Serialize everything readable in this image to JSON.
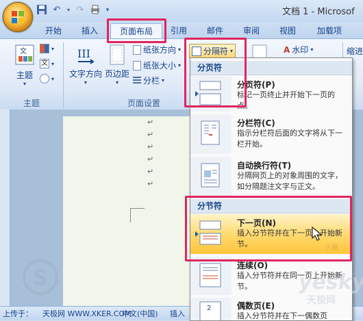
{
  "window": {
    "title": "文档 1 - Microsof"
  },
  "quick_access": {
    "icons": [
      "save-icon",
      "undo-icon",
      "redo-icon",
      "print-icon",
      "customize-icon"
    ]
  },
  "tabs": [
    {
      "label": "开始"
    },
    {
      "label": "插入"
    },
    {
      "label": "页面布局",
      "active": true
    },
    {
      "label": "引用"
    },
    {
      "label": "邮件"
    },
    {
      "label": "审阅"
    },
    {
      "label": "视图"
    },
    {
      "label": "加载项"
    }
  ],
  "ribbon": {
    "theme_group": {
      "theme_label": "主题",
      "group_label": "主题"
    },
    "page_setup_group": {
      "text_direction_label": "文字方向",
      "margins_label": "页边距",
      "orientation_label": "纸张方向",
      "size_label": "纸张大小",
      "columns_label": "分栏",
      "breaks_label": "分隔符",
      "group_label": "页面设置"
    },
    "background_group": {
      "watermark_label": "水印"
    },
    "indent_label": "缩进"
  },
  "breaks_menu": {
    "page_breaks_header": "分页符",
    "section_breaks_header": "分节符",
    "items": [
      {
        "title": "分页符(P)",
        "desc": "标记一页终止并开始下一页的点。"
      },
      {
        "title": "分栏符(C)",
        "desc": "指示分栏符后面的文字将从下一栏开始。"
      },
      {
        "title": "自动换行符(T)",
        "desc": "分隔网页上的对象周围的文字，如分隔题注文字与正文。"
      },
      {
        "title": "下一页(N)",
        "desc": "插入分节符并在下一页上开始新节。",
        "selected": true
      },
      {
        "title": "连续(O)",
        "desc": "插入分节符并在同一页上开始新节。"
      },
      {
        "title": "偶数页(E)",
        "desc": "插入分节符并在下一偶数页"
      }
    ]
  },
  "statusbar": {
    "left_text": "上传于：",
    "watermark_site": "天极网 WWW.XKER.COM",
    "language": "中文(中国)",
    "insert_mode": "插入"
  },
  "watermarks": {
    "small_tag": "小易",
    "brand_top": "yesky",
    "brand_bottom": "天极网"
  },
  "colors": {
    "highlight": "#e0245e",
    "selected_item": "#ffd86b",
    "ribbon_text": "#15428b"
  }
}
